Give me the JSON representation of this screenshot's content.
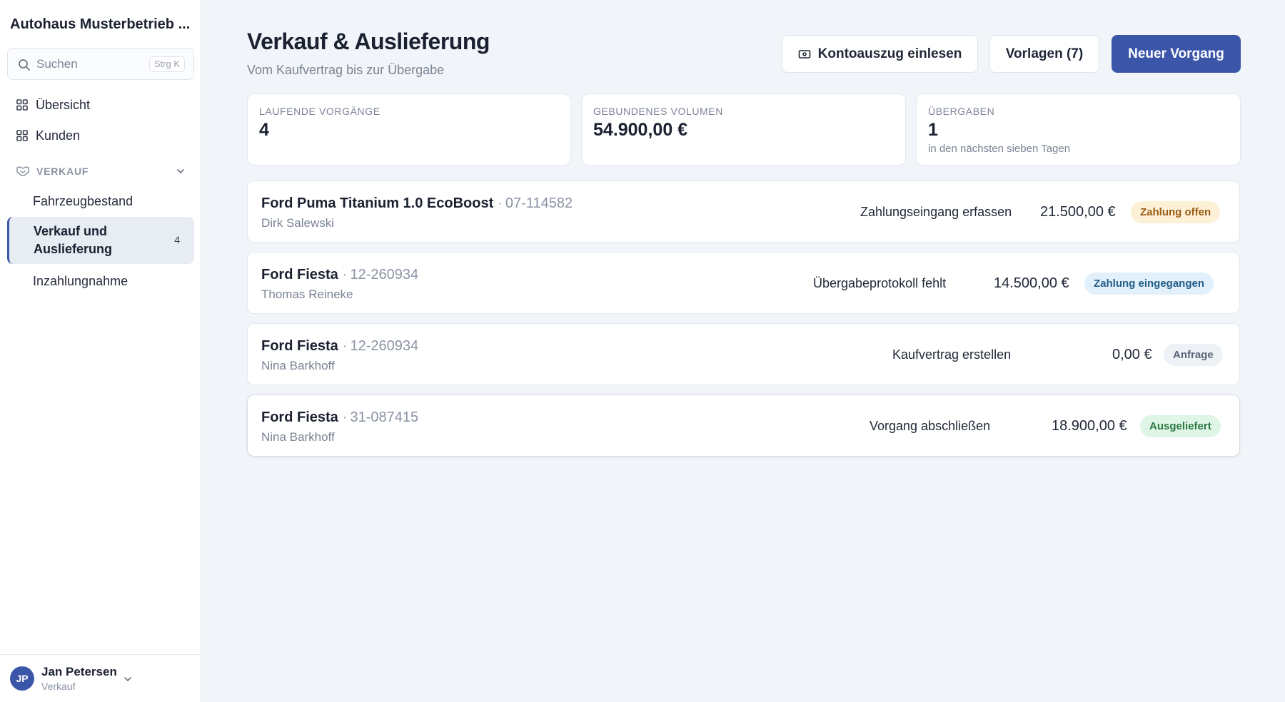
{
  "app": {
    "title": "Autohaus Musterbetrieb ..."
  },
  "search": {
    "placeholder": "Suchen",
    "shortcut": "Strg K"
  },
  "sidebar": {
    "items": [
      {
        "label": "Übersicht",
        "icon": "grid-icon"
      },
      {
        "label": "Kunden",
        "icon": "grid-icon"
      }
    ],
    "section": {
      "label": "VERKAUF",
      "icon": "handshake-icon"
    },
    "sub_items": [
      {
        "label": "Fahrzeugbestand"
      },
      {
        "label": "Verkauf und Auslieferung",
        "count": "4",
        "active": true
      },
      {
        "label": "Inzahlungnahme"
      }
    ]
  },
  "user": {
    "initials": "JP",
    "name": "Jan Petersen",
    "role": "Verkauf"
  },
  "header": {
    "title": "Verkauf & Auslieferung",
    "subtitle": "Vom Kaufvertrag bis zur Übergabe",
    "buttons": {
      "import": "Kontoauszug einlesen",
      "templates": "Vorlagen (7)",
      "new": "Neuer Vorgang"
    }
  },
  "stats": [
    {
      "label": "LAUFENDE VORGÄNGE",
      "value": "4",
      "hint": ""
    },
    {
      "label": "GEBUNDENES VOLUMEN",
      "value": "54.900,00 €",
      "hint": ""
    },
    {
      "label": "ÜBERGABEN",
      "value": "1",
      "hint": "in den nächsten sieben Tagen"
    }
  ],
  "deals": [
    {
      "model": "Ford Puma Titanium 1.0 EcoBoost",
      "sep": "·",
      "plate": "07-114582",
      "customer": "Dirk Salewski",
      "task": "Zahlungseingang erfassen",
      "amount": "21.500,00 €",
      "status": "Zahlung offen"
    },
    {
      "model": "Ford Fiesta",
      "sep": "·",
      "plate": "12-260934",
      "customer": "Thomas Reineke",
      "task": "Übergabeprotokoll fehlt",
      "amount": "14.500,00 €",
      "status": "Zahlung eingegangen"
    },
    {
      "model": "Ford Fiesta",
      "sep": "·",
      "plate": "12-260934",
      "customer": "Nina Barkhoff",
      "task": "Kaufvertrag erstellen",
      "amount": "0,00 €",
      "status": "Anfrage"
    },
    {
      "model": "Ford Fiesta",
      "sep": "·",
      "plate": "31-087415",
      "customer": "Nina Barkhoff",
      "task": "Vorgang abschließen",
      "amount": "18.900,00 €",
      "status": "Ausgeliefert"
    }
  ],
  "colors": {
    "accent": "#3b56a8",
    "status_open": "#9a5b13",
    "status_received": "#235d87",
    "status_request": "#5b6577",
    "status_delivered": "#2c7a45"
  }
}
